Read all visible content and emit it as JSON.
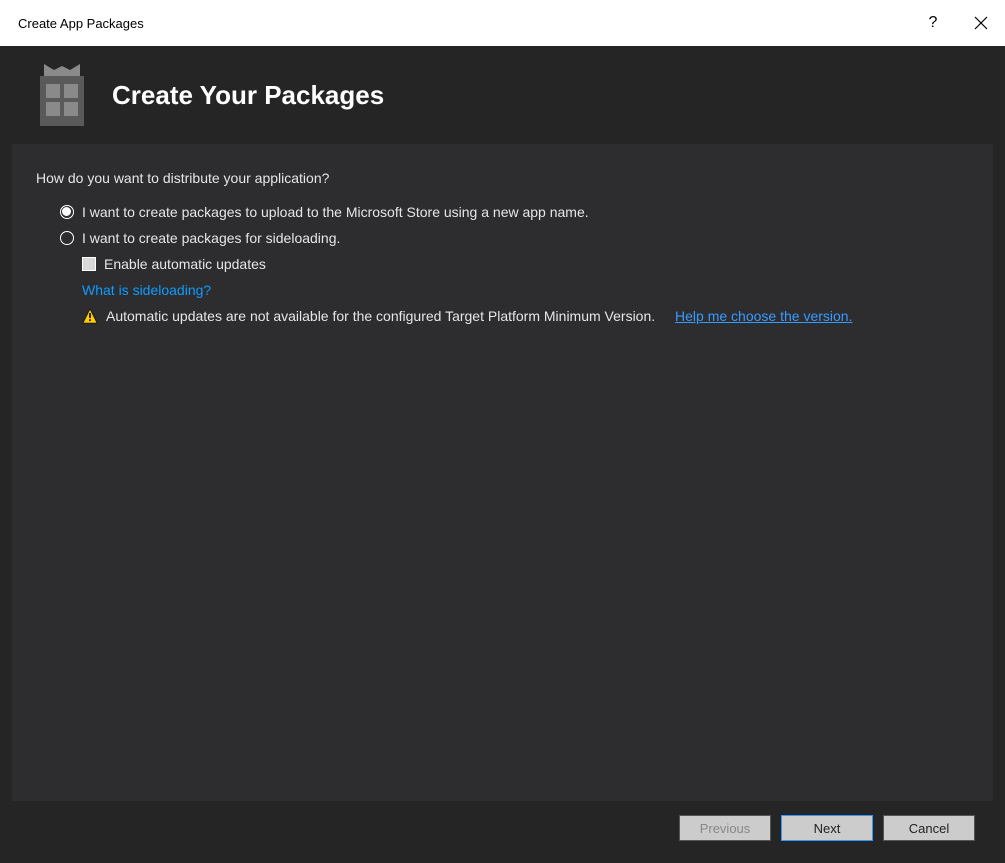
{
  "titlebar": {
    "title": "Create App Packages",
    "help": "?"
  },
  "header": {
    "heading": "Create Your Packages"
  },
  "content": {
    "question": "How do you want to distribute your application?",
    "option_store": "I want to create packages to upload to the Microsoft Store using a new app name.",
    "option_sideload": "I want to create packages for sideloading.",
    "enable_updates": "Enable automatic updates",
    "what_is_sideloading": "What is sideloading?",
    "warning_text": "Automatic updates are not available for the configured Target Platform Minimum Version.",
    "help_version_link": "Help me choose the version."
  },
  "footer": {
    "previous": "Previous",
    "next": "Next",
    "cancel": "Cancel"
  }
}
